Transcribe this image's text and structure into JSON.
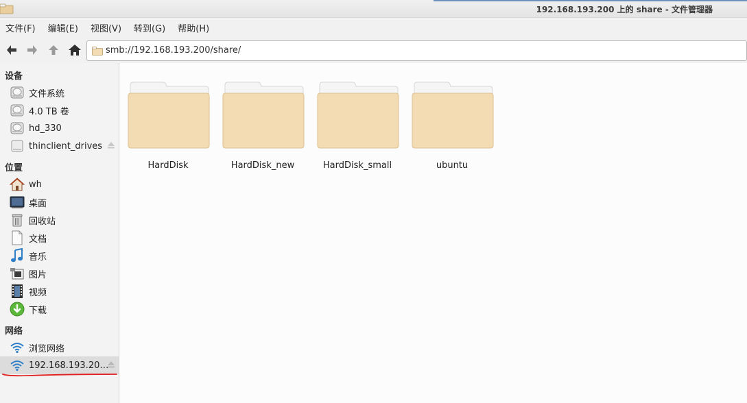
{
  "window": {
    "title": "192.168.193.200 上的 share - 文件管理器"
  },
  "menu": [
    "文件(F)",
    "编辑(E)",
    "视图(V)",
    "转到(G)",
    "帮助(H)"
  ],
  "toolbar": {
    "back_icon": "arrow-left-icon",
    "forward_icon": "arrow-right-icon",
    "up_icon": "arrow-up-icon",
    "home_icon": "home-icon",
    "address": "smb://192.168.193.200/share/"
  },
  "sidebar": {
    "devices_header": "设备",
    "devices": [
      {
        "label": "文件系统",
        "icon": "drive-icon"
      },
      {
        "label": "4.0 TB 卷",
        "icon": "drive-icon"
      },
      {
        "label": "hd_330",
        "icon": "drive-icon"
      },
      {
        "label": "thinclient_drives",
        "icon": "drive-icon",
        "eject": true
      }
    ],
    "places_header": "位置",
    "places": [
      {
        "label": "wh",
        "icon": "home-icon"
      },
      {
        "label": "桌面",
        "icon": "desktop-icon"
      },
      {
        "label": "回收站",
        "icon": "trash-icon"
      },
      {
        "label": "文档",
        "icon": "document-icon"
      },
      {
        "label": "音乐",
        "icon": "music-icon"
      },
      {
        "label": "图片",
        "icon": "picture-icon"
      },
      {
        "label": "视频",
        "icon": "video-icon"
      },
      {
        "label": "下载",
        "icon": "download-icon"
      }
    ],
    "network_header": "网络",
    "network": [
      {
        "label": "浏览网络",
        "icon": "wifi-icon"
      },
      {
        "label": "192.168.193.20…",
        "icon": "wifi-icon",
        "eject": true,
        "selected": true
      }
    ]
  },
  "folders": [
    {
      "name": "HardDisk"
    },
    {
      "name": "HardDisk_new"
    },
    {
      "name": "HardDisk_small"
    },
    {
      "name": "ubuntu"
    }
  ],
  "colors": {
    "folder_body": "#f3dcb4",
    "folder_tab": "#f4f4f4",
    "annotation_red": "#e02020",
    "wifi_blue": "#2f7fc8"
  }
}
